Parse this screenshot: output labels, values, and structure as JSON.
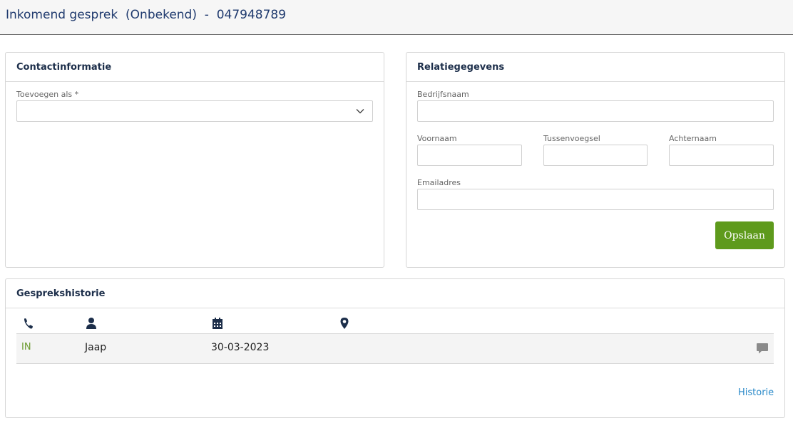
{
  "header": {
    "title": "Inkomend gesprek  (Onbekend)  -  047948789"
  },
  "contact": {
    "title": "Contactinformatie",
    "add_as_label": "Toevoegen als *",
    "add_as_value": ""
  },
  "relation": {
    "title": "Relatiegegevens",
    "company_label": "Bedrijfsnaam",
    "firstname_label": "Voornaam",
    "infix_label": "Tussenvoegsel",
    "lastname_label": "Achternaam",
    "email_label": "Emailadres",
    "save_label": "Opslaan"
  },
  "history": {
    "title": "Gesprekshistorie",
    "columns": [
      "phone-icon",
      "user-icon",
      "calendar-icon",
      "location-pin-icon"
    ],
    "rows": [
      {
        "direction": "IN",
        "name": "Jaap",
        "date": "30-03-2023",
        "location": ""
      }
    ],
    "link_label": "Historie"
  },
  "colors": {
    "brand_blue": "#1f3a6e",
    "accent_green": "#5e9a1c",
    "link_blue": "#2b8ac9"
  }
}
